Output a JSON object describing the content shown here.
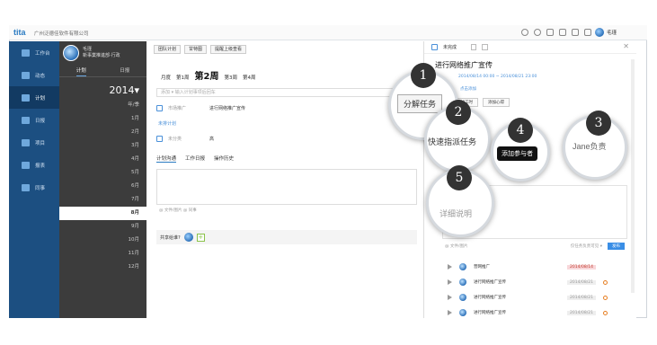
{
  "app": {
    "logo": "tita",
    "company": "广州泛德佳软件有限公司",
    "user": "毛瑾"
  },
  "nav": [
    {
      "label": "工作台",
      "active": false
    },
    {
      "label": "动态",
      "active": false
    },
    {
      "label": "计划",
      "active": true
    },
    {
      "label": "日报",
      "active": false
    },
    {
      "label": "项目",
      "active": false
    },
    {
      "label": "报表",
      "active": false
    },
    {
      "label": "同事",
      "active": false
    }
  ],
  "panel": {
    "user_name": "毛瑾",
    "user_sub": "新事業推進部·行政",
    "tabs": [
      "计划",
      "日报"
    ],
    "year": "2014▾",
    "months": [
      "年/季",
      "1月",
      "2月",
      "3月",
      "4月",
      "5月",
      "6月",
      "7月",
      "8月",
      "9月",
      "10月",
      "11月",
      "12月"
    ],
    "selected_month": "8月"
  },
  "main": {
    "buttons": [
      "团队计划",
      "甘特图",
      "提醒上级查看"
    ],
    "weeks": [
      "月度",
      "第1周",
      "第2周",
      "第3周",
      "第4周"
    ],
    "search_placeholder": "添加 ▾   输入计划事项后回车",
    "tasks": [
      {
        "owner": "市场推广",
        "name": "进行网络推广宣传"
      },
      {
        "owner": "未分类",
        "name": "高"
      }
    ],
    "unsorted": "未排计划",
    "tabs": [
      "计划沟通",
      "工作日报",
      "操作历史"
    ],
    "attach": "@ 文件/图片  @ 同事",
    "share_label": "共享给谁?"
  },
  "right": {
    "header": "未完成",
    "title": "进行网络推广宣传",
    "dates": "2014/08/14 00:00 ~ 2014/08/21 23:00",
    "add_link": "点击添加",
    "buttons": [
      "添加工时",
      "添加心得"
    ],
    "editor_bar_left": "@ 文件/图片",
    "editor_bar_mid": "仅任务负责可见 ▾",
    "send": "发布",
    "subtasks": [
      {
        "name": "营网推广",
        "date": "2014/08/14",
        "overdue": true
      },
      {
        "name": "进行网络推广宣传",
        "date": "2014/08/21",
        "overdue": false
      },
      {
        "name": "进行网络推广宣传",
        "date": "2014/08/21",
        "overdue": false
      },
      {
        "name": "进行网络推广宣传",
        "date": "2014/08/21",
        "overdue": false
      },
      {
        "name": "进行网络推广宣传",
        "date": "2014/08/28",
        "overdue": true
      }
    ]
  },
  "callouts": [
    {
      "num": "1",
      "text": "分解任务"
    },
    {
      "num": "2",
      "text": "快速指派任务"
    },
    {
      "num": "4",
      "text": "添加参与者"
    },
    {
      "num": "3",
      "text": "Jane负责"
    },
    {
      "num": "5",
      "text": "详细说明"
    }
  ]
}
